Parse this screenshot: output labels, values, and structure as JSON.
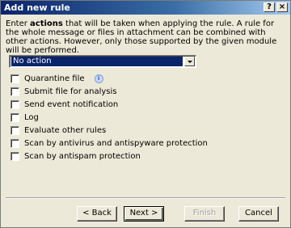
{
  "window": {
    "title": "Add new rule",
    "help_label": "?",
    "close_label": "×"
  },
  "description": {
    "prefix": "Enter ",
    "bold": "actions",
    "suffix": " that will be taken when applying the rule. A rule for the whole message or files in attachment can be combined with other actions. However, only those supported by the given module will be performed."
  },
  "action_select": {
    "value": "No action"
  },
  "options": [
    {
      "label": "Quarantine file",
      "checked": false,
      "info": true
    },
    {
      "label": "Submit file for analysis",
      "checked": false
    },
    {
      "label": "Send event notification",
      "checked": false
    },
    {
      "label": "Log",
      "checked": false
    },
    {
      "label": "Evaluate other rules",
      "checked": false
    },
    {
      "label": "Scan by antivirus and antispyware protection",
      "checked": false
    },
    {
      "label": "Scan by antispam protection",
      "checked": false
    }
  ],
  "buttons": {
    "back": "< Back",
    "next": "Next >",
    "finish": "Finish",
    "cancel": "Cancel"
  },
  "colors": {
    "titlebar_start": "#0a246a",
    "selection": "#0a246a"
  }
}
